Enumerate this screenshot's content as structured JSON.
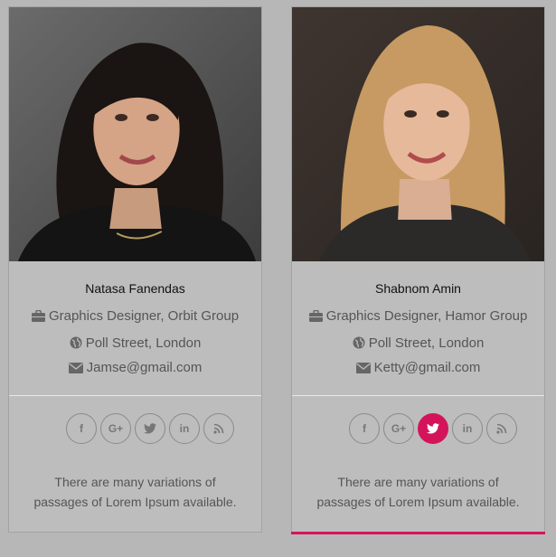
{
  "colors": {
    "accent": "#d4145a",
    "background": "#b7b7b7",
    "text": "#555555"
  },
  "cards": [
    {
      "name": "Natasa Fanendas",
      "role": "Graphics Designer, Orbit Group",
      "location": "Poll Street, London",
      "email": "Jamse@gmail.com",
      "description_line1": "There are many variations of",
      "description_line2": "passages of Lorem Ipsum available.",
      "social": [
        {
          "icon": "facebook-icon",
          "glyph": "f",
          "active": false
        },
        {
          "icon": "google-plus-icon",
          "glyph": "G+",
          "active": false
        },
        {
          "icon": "twitter-icon",
          "glyph": "t",
          "active": false
        },
        {
          "icon": "linkedin-icon",
          "glyph": "in",
          "active": false
        },
        {
          "icon": "rss-icon",
          "glyph": "rss",
          "active": false
        }
      ]
    },
    {
      "name": "Shabnom Amin",
      "role": "Graphics Designer, Hamor Group",
      "location": "Poll Street, London",
      "email": "Ketty@gmail.com",
      "description_line1": "There are many variations of",
      "description_line2": "passages of Lorem Ipsum available.",
      "social": [
        {
          "icon": "facebook-icon",
          "glyph": "f",
          "active": false
        },
        {
          "icon": "google-plus-icon",
          "glyph": "G+",
          "active": false
        },
        {
          "icon": "twitter-icon",
          "glyph": "t",
          "active": true
        },
        {
          "icon": "linkedin-icon",
          "glyph": "in",
          "active": false
        },
        {
          "icon": "rss-icon",
          "glyph": "rss",
          "active": false
        }
      ]
    }
  ]
}
